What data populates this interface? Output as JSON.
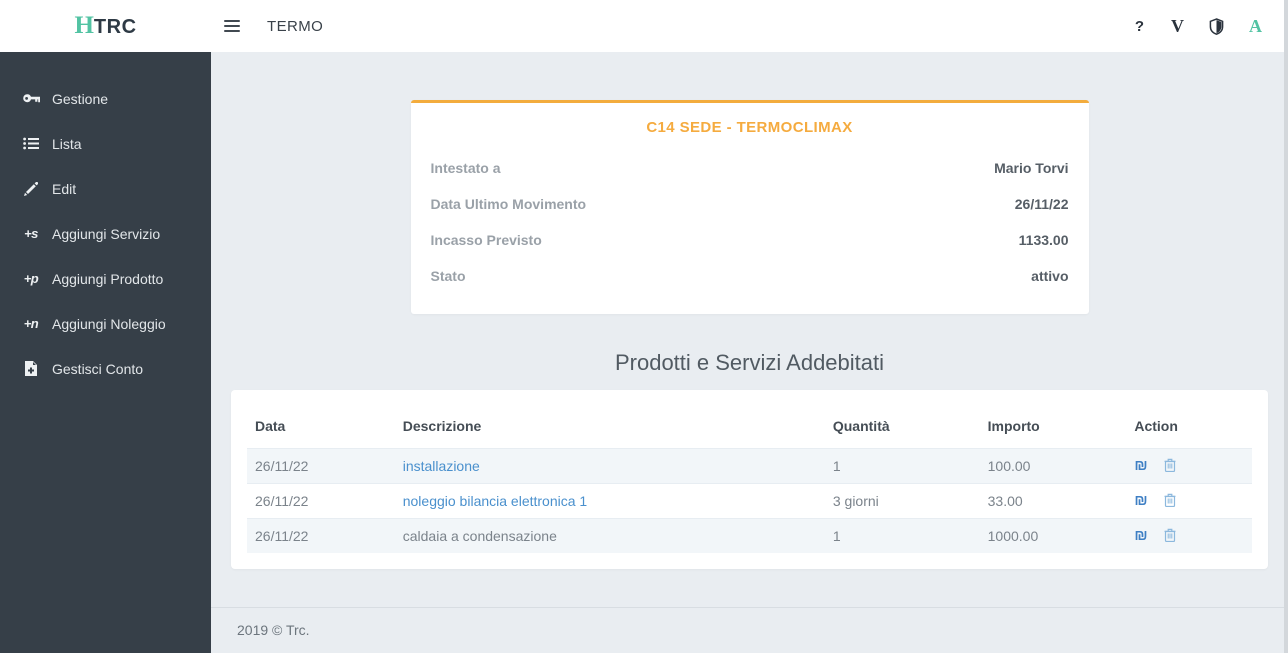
{
  "navbar": {
    "logo": {
      "accent_letter": "H",
      "rest": "TRC"
    },
    "app_title": "TERMO",
    "icons": {
      "help": "?",
      "v": "V",
      "a": "A"
    }
  },
  "sidebar": {
    "items": [
      {
        "icon": "key-icon",
        "label": "Gestione"
      },
      {
        "icon": "list-icon",
        "label": "Lista"
      },
      {
        "icon": "pencil-icon",
        "label": "Edit"
      },
      {
        "icon": "plus-s-icon",
        "icon_text": "+s",
        "label": "Aggiungi Servizio"
      },
      {
        "icon": "plus-p-icon",
        "icon_text": "+p",
        "label": "Aggiungi Prodotto"
      },
      {
        "icon": "plus-n-icon",
        "icon_text": "+n",
        "label": "Aggiungi Noleggio"
      },
      {
        "icon": "file-plus-icon",
        "label": "Gestisci Conto"
      }
    ]
  },
  "account_card": {
    "title": "C14 SEDE - TERMOCLIMAX",
    "fields": [
      {
        "label": "Intestato a",
        "value": "Mario Torvi"
      },
      {
        "label": "Data Ultimo Movimento",
        "value": "26/11/22"
      },
      {
        "label": "Incasso Previsto",
        "value": "1133.00"
      },
      {
        "label": "Stato",
        "value": "attivo"
      }
    ]
  },
  "section": {
    "heading": "Prodotti e Servizi Addebitati",
    "table": {
      "headers": [
        "Data",
        "Descrizione",
        "Quantità",
        "Importo",
        "Action"
      ],
      "payment_glyph": "₪",
      "rows": [
        {
          "data": "26/11/22",
          "descrizione": "installazione",
          "quantita": "1",
          "importo": "100.00"
        },
        {
          "data": "26/11/22",
          "descrizione": "noleggio bilancia elettronica 1",
          "quantita": "3 giorni",
          "importo": "33.00"
        },
        {
          "data": "26/11/22",
          "descrizione": "caldaia a condensazione",
          "quantita": "1",
          "importo": "1000.00"
        }
      ]
    }
  },
  "footer": {
    "text": "2019 © Trc."
  },
  "colors": {
    "accent_teal": "#52c3a3",
    "accent_orange": "#f5ab3f",
    "sidebar_bg": "#363f48",
    "link_blue": "#4a90cd",
    "payment_icon_blue": "#3e7fc4",
    "delete_icon_blue": "#8cb8dd",
    "content_bg": "#e9edf1",
    "stripe_bg": "#f2f6f9"
  }
}
